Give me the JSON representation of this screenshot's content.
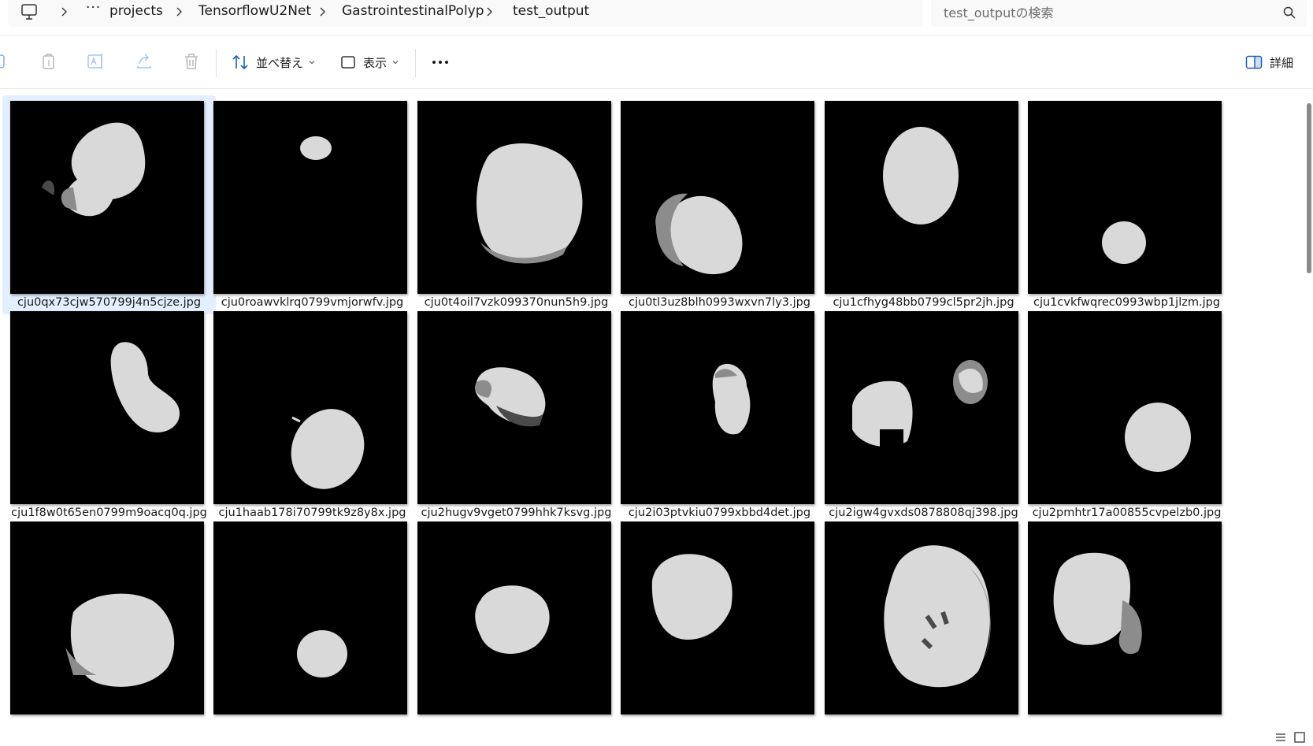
{
  "breadcrumb": {
    "more": "···",
    "items": [
      "projects",
      "TensorflowU2Net",
      "GastrointestinalPolyp",
      "test_output"
    ]
  },
  "search": {
    "placeholder": "test_outputの検索"
  },
  "toolbar": {
    "sort_label": "並べ替え",
    "view_label": "表示",
    "details_label": "詳細"
  },
  "files": [
    {
      "name": "cju0qx73cjw570799j4n5cjze.jpg",
      "selected": true
    },
    {
      "name": "cju0roawvklrq0799vmjorwfv.jpg",
      "selected": false
    },
    {
      "name": "cju0t4oil7vzk099370nun5h9.jpg",
      "selected": false
    },
    {
      "name": "cju0tl3uz8blh0993wxvn7ly3.jpg",
      "selected": false
    },
    {
      "name": "cju1cfhyg48bb0799cl5pr2jh.jpg",
      "selected": false
    },
    {
      "name": "cju1cvkfwqrec0993wbp1jlzm.jpg",
      "selected": false
    },
    {
      "name": "cju1f8w0t65en0799m9oacq0q.jpg",
      "selected": false
    },
    {
      "name": "cju1haab178i70799tk9z8y8x.jpg",
      "selected": false
    },
    {
      "name": "cju2hugv9vget0799hhk7ksvg.jpg",
      "selected": false
    },
    {
      "name": "cju2i03ptvkiu0799xbbd4det.jpg",
      "selected": false
    },
    {
      "name": "cju2igw4gvxds0878808qj398.jpg",
      "selected": false
    },
    {
      "name": "cju2pmhtr17a00855cvpelzb0.jpg",
      "selected": false
    },
    {
      "name": "",
      "selected": false
    },
    {
      "name": "",
      "selected": false
    },
    {
      "name": "",
      "selected": false
    },
    {
      "name": "",
      "selected": false
    },
    {
      "name": "",
      "selected": false
    },
    {
      "name": "",
      "selected": false
    }
  ],
  "colors": {
    "selected_tile": "#e3efff",
    "mask_white": "#d9d9d9",
    "mask_gray": "#8c8c8c"
  }
}
